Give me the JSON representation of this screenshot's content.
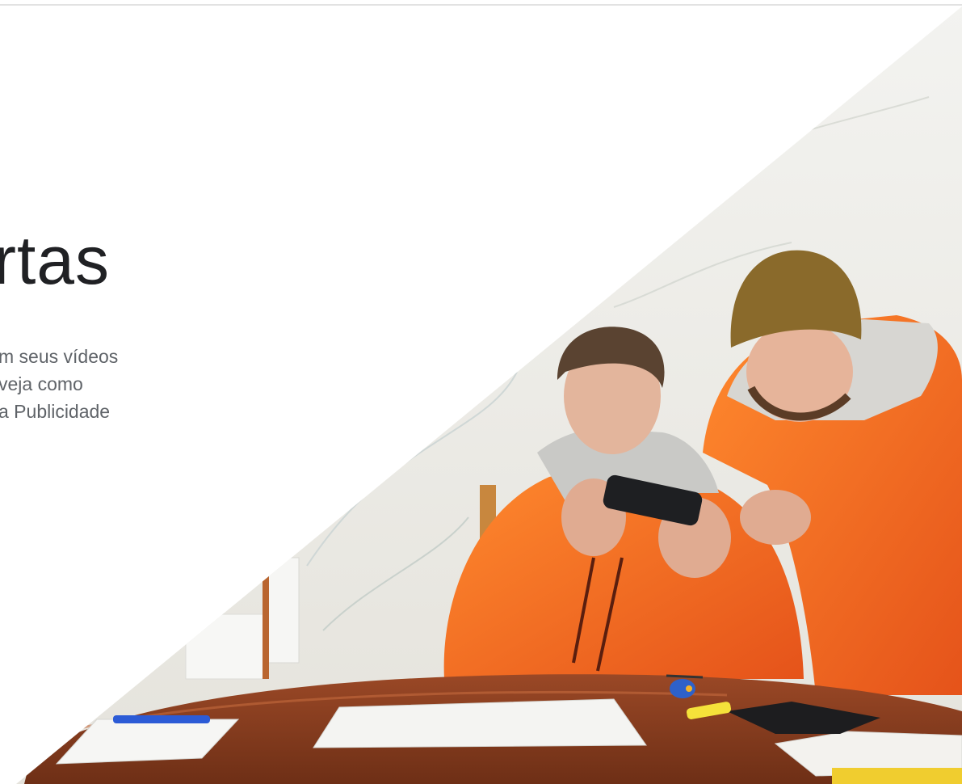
{
  "hero": {
    "headline": "rtas",
    "body_lines": [
      "m seus vídeos",
      "veja como",
      "a Publicidade"
    ]
  },
  "photo": {
    "image_name": "two-men-in-orange-jackets-looking-at-phone-photo"
  },
  "colors": {
    "headline": "#202124",
    "body": "#5f6368",
    "jacket": "#f26a1b",
    "beanie": "#8a6a2b",
    "table": "#8a3d1f",
    "top_rule": "#e2e2e2"
  }
}
